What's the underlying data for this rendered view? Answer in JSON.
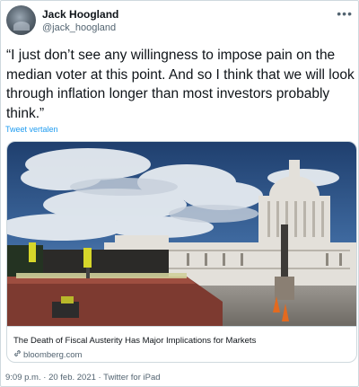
{
  "author": {
    "name": "Jack Hoogland",
    "handle": "@jack_hoogland"
  },
  "more_icon": "more-dots-icon",
  "tweet": {
    "text": "“I just don’t see any willingness to impose pain on the median voter at this point. And so I think that we will look through inflation longer than most investors probably think.”",
    "translate_label": "Tweet vertalen"
  },
  "card": {
    "title": "The Death of Fiscal Austerity Has Major Implications for Markets",
    "domain": "bloomberg.com",
    "link_icon": "link-icon"
  },
  "footer": {
    "time": "9:09 p.m.",
    "separator": " · ",
    "date": "20 feb. 2021",
    "source": "Twitter for iPad"
  },
  "colors": {
    "accent": "#1d9bf0",
    "secondary_text": "#536471",
    "border": "#cfd9de"
  }
}
